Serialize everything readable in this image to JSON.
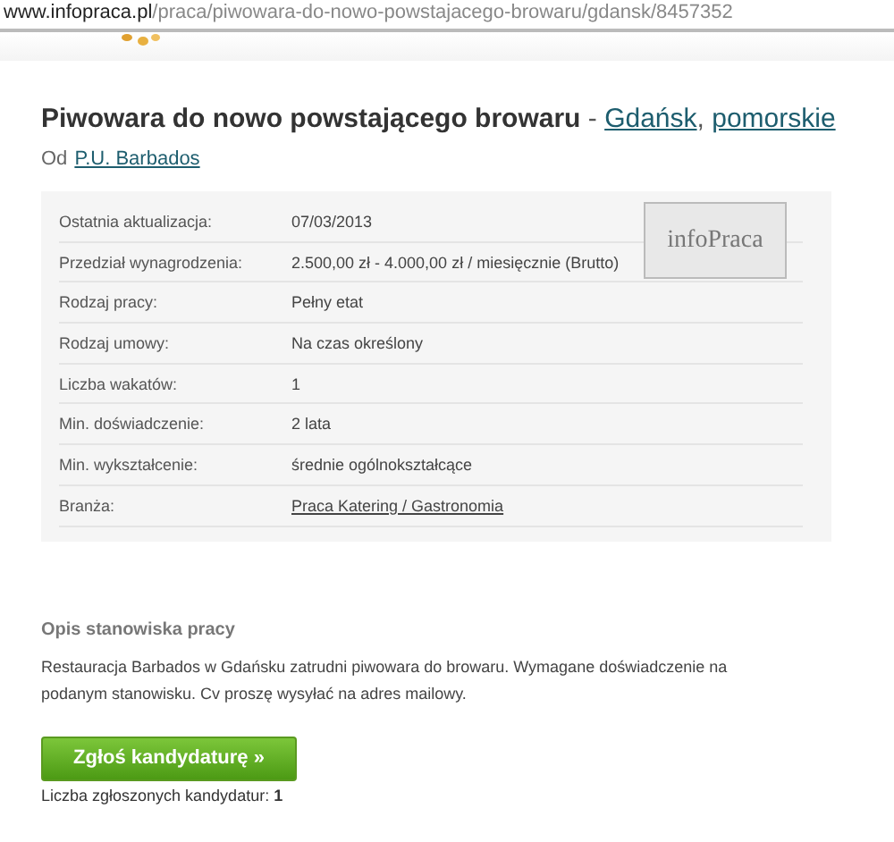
{
  "address_bar": {
    "host": "www.infopraca.pl",
    "path": "/praca/piwowara-do-nowo-powstajacego-browaru/gdansk/8457352"
  },
  "job": {
    "title": "Piwowara do nowo powstającego browaru",
    "separator": " - ",
    "locations": [
      {
        "text": "Gdańsk"
      },
      {
        "text": "pomorskie"
      }
    ],
    "location_separator": ",",
    "from_label": "Od",
    "company": "P.U. Barbados"
  },
  "details": [
    {
      "label": "Ostatnia aktualizacja:",
      "value": "07/03/2013",
      "kind": "text"
    },
    {
      "label": "Przedział wynagrodzenia:",
      "value": "2.500,00 zł - 4.000,00 zł / miesięcznie (Brutto)",
      "kind": "text"
    },
    {
      "label": "Rodzaj pracy:",
      "value": "Pełny etat",
      "kind": "text"
    },
    {
      "label": "Rodzaj umowy:",
      "value": "Na czas określony",
      "kind": "text"
    },
    {
      "label": "Liczba wakatów:",
      "value": "1",
      "kind": "text"
    },
    {
      "label": "Min. doświadczenie:",
      "value": "2 lata",
      "kind": "text"
    },
    {
      "label": "Min. wykształcenie:",
      "value": "średnie ogólnokształcące",
      "kind": "text"
    },
    {
      "label": "Branża:",
      "value": "Praca Katering / Gastronomia",
      "kind": "link"
    }
  ],
  "company_logo": {
    "text": "infoPraca"
  },
  "description": {
    "heading": "Opis stanowiska pracy",
    "text": "Restauracja Barbados w Gdańsku zatrudni piwowara do browaru. Wymagane doświadczenie na podanym stanowisku. Cv proszę wysyłać na adres mailowy."
  },
  "apply_button": {
    "label": "Zgłoś kandydaturę",
    "arrow": "»"
  },
  "applications_count": "Liczba zgłoszonych kandydatur: **1**"
}
